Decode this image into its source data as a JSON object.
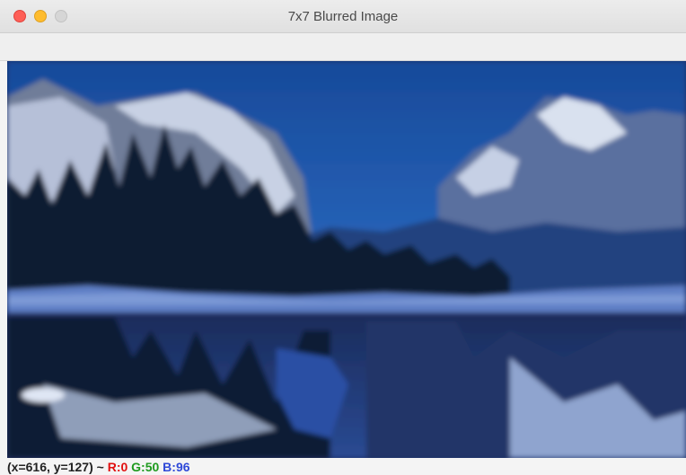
{
  "window": {
    "title": "7x7 Blurred Image"
  },
  "status": {
    "coords": "(x=616, y=127) ~",
    "r": "R:0",
    "g": "G:50",
    "b": "B:96"
  },
  "colors": {
    "status_r": "#e10f0f",
    "status_g": "#1e9a1e",
    "status_b": "#2f49d8"
  }
}
